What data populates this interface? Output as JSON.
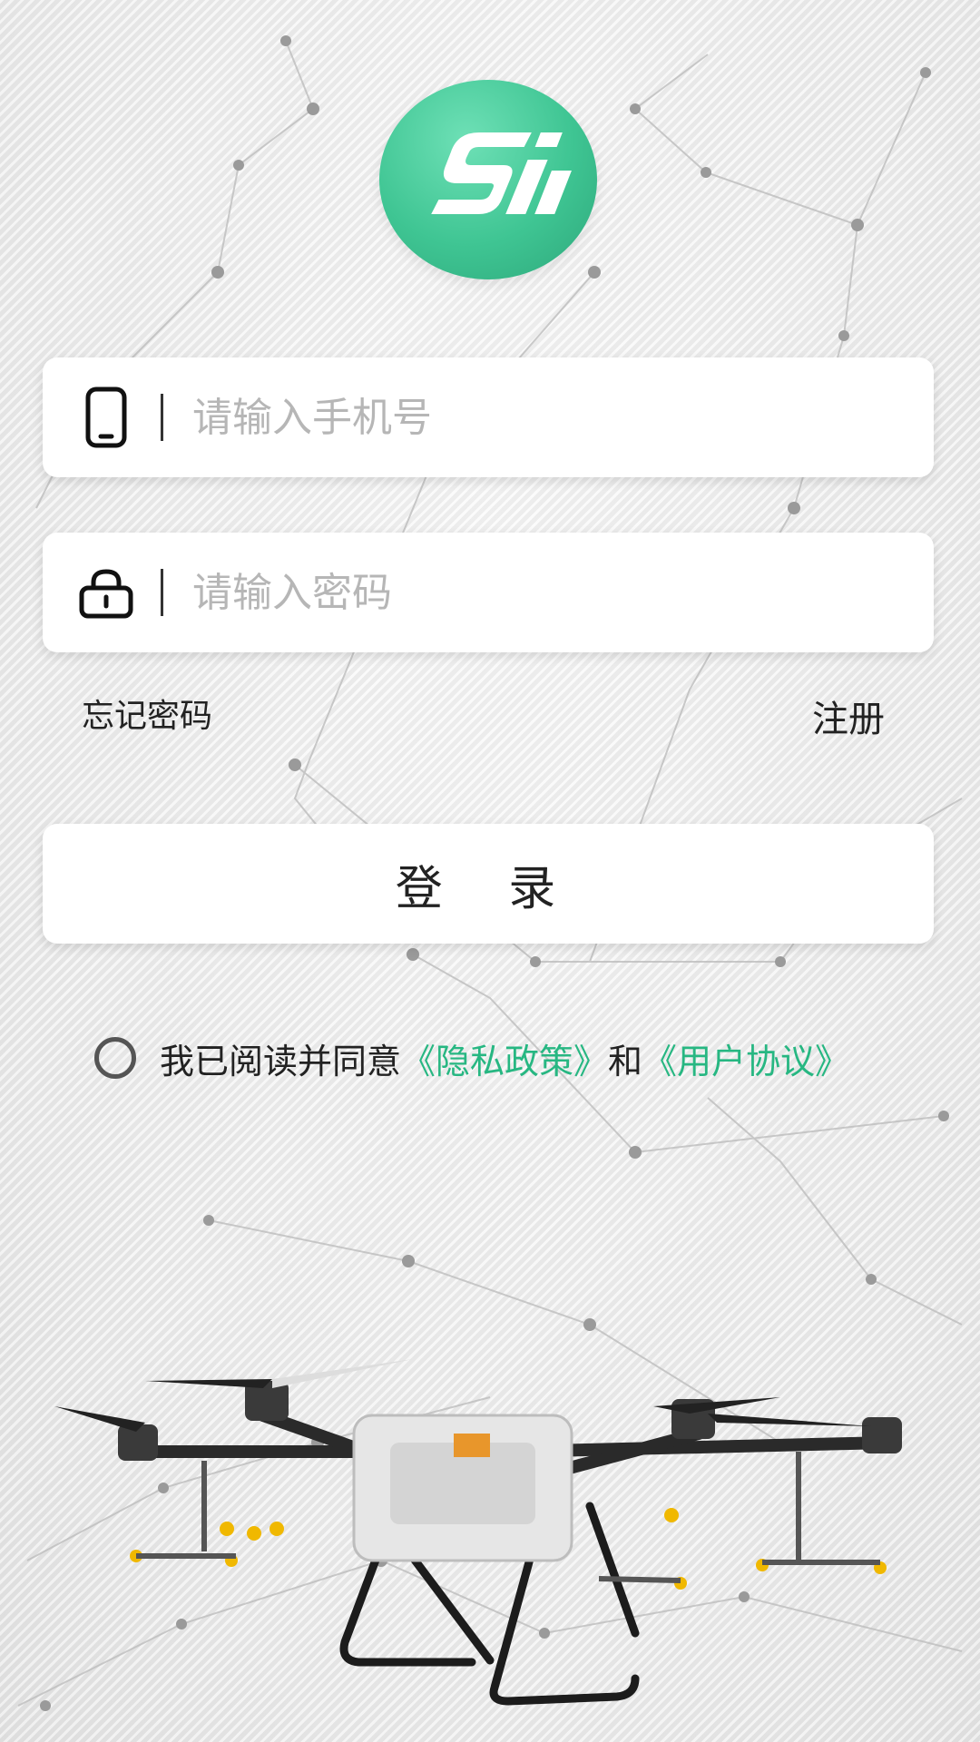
{
  "login": {
    "phone_placeholder": "请输入手机号",
    "password_placeholder": "请输入密码",
    "forgot_password": "忘记密码",
    "register": "注册",
    "login_button": "登 录"
  },
  "agreement": {
    "prefix": "我已阅读并同意",
    "privacy_policy": "《隐私政策》",
    "and": "和",
    "user_agreement": "《用户协议》"
  },
  "icons": {
    "logo": "sj-logo",
    "phone": "phone-icon",
    "lock": "lock-icon",
    "radio": "radio-unchecked-icon"
  },
  "colors": {
    "accent": "#27b782",
    "logo_green": "#3fc593"
  }
}
